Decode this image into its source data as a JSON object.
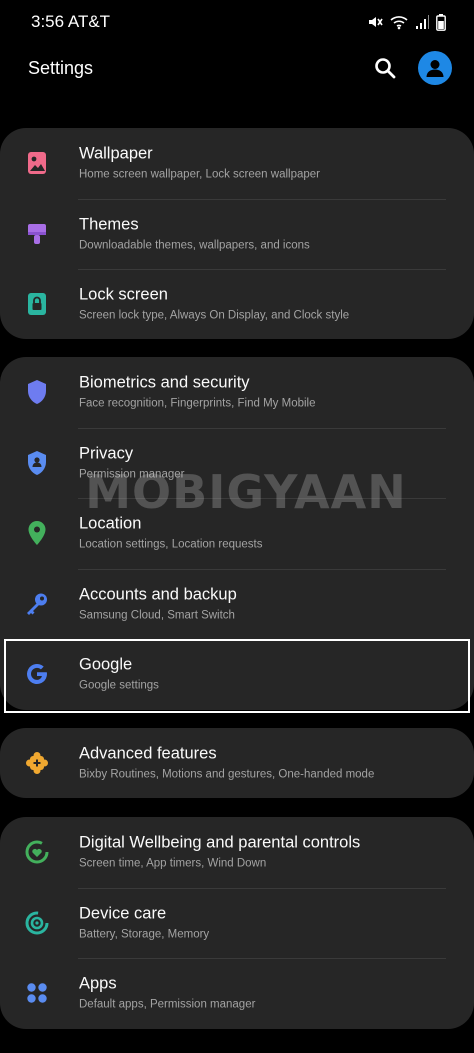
{
  "status_bar": {
    "time": "3:56 AT&T"
  },
  "header": {
    "title": "Settings"
  },
  "watermark": "MOBIGYAAN",
  "groups": [
    [
      {
        "title": "Wallpaper",
        "subtitle": "Home screen wallpaper, Lock screen wallpaper",
        "icon": "wallpaper-icon",
        "color": "#f06a8a"
      },
      {
        "title": "Themes",
        "subtitle": "Downloadable themes, wallpapers, and icons",
        "icon": "themes-icon",
        "color": "#a86ee6"
      },
      {
        "title": "Lock screen",
        "subtitle": "Screen lock type, Always On Display, and Clock style",
        "icon": "lock-icon",
        "color": "#2ab5a0"
      }
    ],
    [
      {
        "title": "Biometrics and security",
        "subtitle": "Face recognition, Fingerprints, Find My Mobile",
        "icon": "shield-icon",
        "color": "#6e7cf0"
      },
      {
        "title": "Privacy",
        "subtitle": "Permission manager",
        "icon": "privacy-shield-icon",
        "color": "#5a8cf0"
      },
      {
        "title": "Location",
        "subtitle": "Location settings, Location requests",
        "icon": "location-pin-icon",
        "color": "#43b05c"
      },
      {
        "title": "Accounts and backup",
        "subtitle": "Samsung Cloud, Smart Switch",
        "icon": "key-icon",
        "color": "#4d7ef0"
      },
      {
        "title": "Google",
        "subtitle": "Google settings",
        "icon": "google-icon",
        "color": "#4d7ef0"
      }
    ],
    [
      {
        "title": "Advanced features",
        "subtitle": "Bixby Routines, Motions and gestures, One-handed mode",
        "icon": "puzzle-icon",
        "color": "#f0a830"
      }
    ],
    [
      {
        "title": "Digital Wellbeing and parental controls",
        "subtitle": "Screen time, App timers, Wind Down",
        "icon": "wellbeing-icon",
        "color": "#43b05c"
      },
      {
        "title": "Device care",
        "subtitle": "Battery, Storage, Memory",
        "icon": "device-care-icon",
        "color": "#2ab5a0"
      },
      {
        "title": "Apps",
        "subtitle": "Default apps, Permission manager",
        "icon": "apps-icon",
        "color": "#5a8cf0"
      }
    ]
  ]
}
